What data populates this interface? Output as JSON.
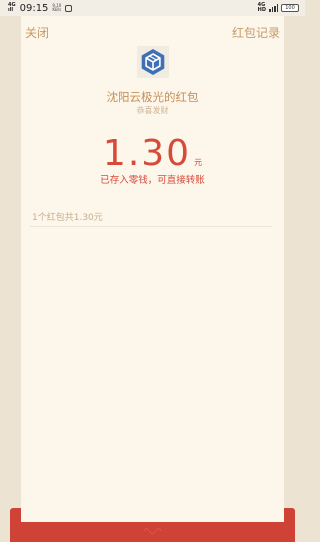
{
  "status_bar": {
    "network": [
      "4G",
      "ıll"
    ],
    "time": "09:15",
    "speed_value": "9.10",
    "speed_unit": "KB/s",
    "signal_label": [
      "4G",
      "HD"
    ],
    "battery": "100"
  },
  "header": {
    "close_label": "关闭",
    "record_label": "红包记录"
  },
  "sender": {
    "name": "沈阳云极光的红包",
    "greeting": "恭喜发财"
  },
  "amount": {
    "value": "1.30",
    "unit": "元",
    "notice": "已存入零钱，可直接转账"
  },
  "summary": {
    "text": "1个红包共1.30元"
  },
  "colors": {
    "accent_gold": "#c79b67",
    "amount_red": "#d64a3a",
    "logo_blue": "#3f6fb5",
    "card_bg": "#fdf6ea",
    "bottom_red": "#cf4336"
  }
}
